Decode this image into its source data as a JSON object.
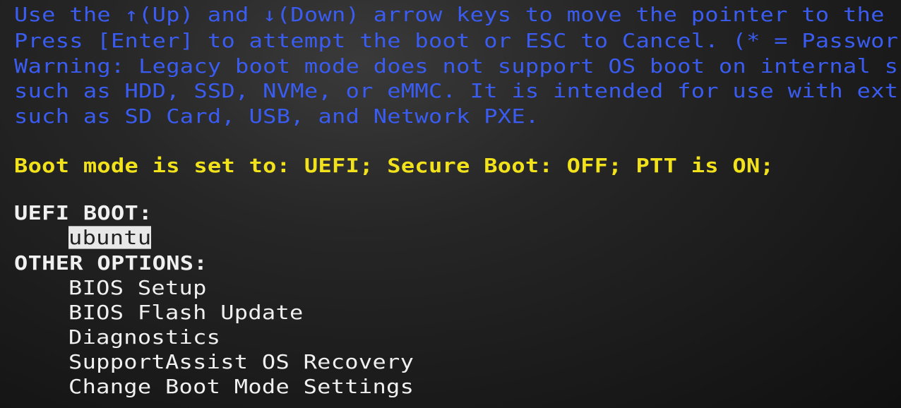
{
  "instructions": [
    "Use the ↑(Up) and ↓(Down) arrow keys to move the pointer to the",
    "Press [Enter] to attempt the boot or ESC to Cancel. (* = Passwor",
    "Warning: Legacy boot mode does not support OS boot on internal s",
    "such as HDD, SSD, NVMe, or eMMC. It is intended for use with ext",
    "such as SD Card, USB, and Network PXE."
  ],
  "status": "Boot mode is set to: UEFI; Secure Boot: OFF; PTT is ON;",
  "uefi_boot": {
    "heading": "UEFI BOOT:",
    "items": [
      "ubuntu"
    ],
    "selected": "ubuntu"
  },
  "other_options": {
    "heading": "OTHER OPTIONS:",
    "items": [
      "BIOS Setup",
      "BIOS Flash Update",
      "Diagnostics",
      "SupportAssist OS Recovery",
      "Change Boot Mode Settings"
    ]
  },
  "colors": {
    "info": "#3a5cf0",
    "status": "#f2e21c",
    "menu": "#f0f0f0",
    "selection": "#e8e8e8"
  }
}
